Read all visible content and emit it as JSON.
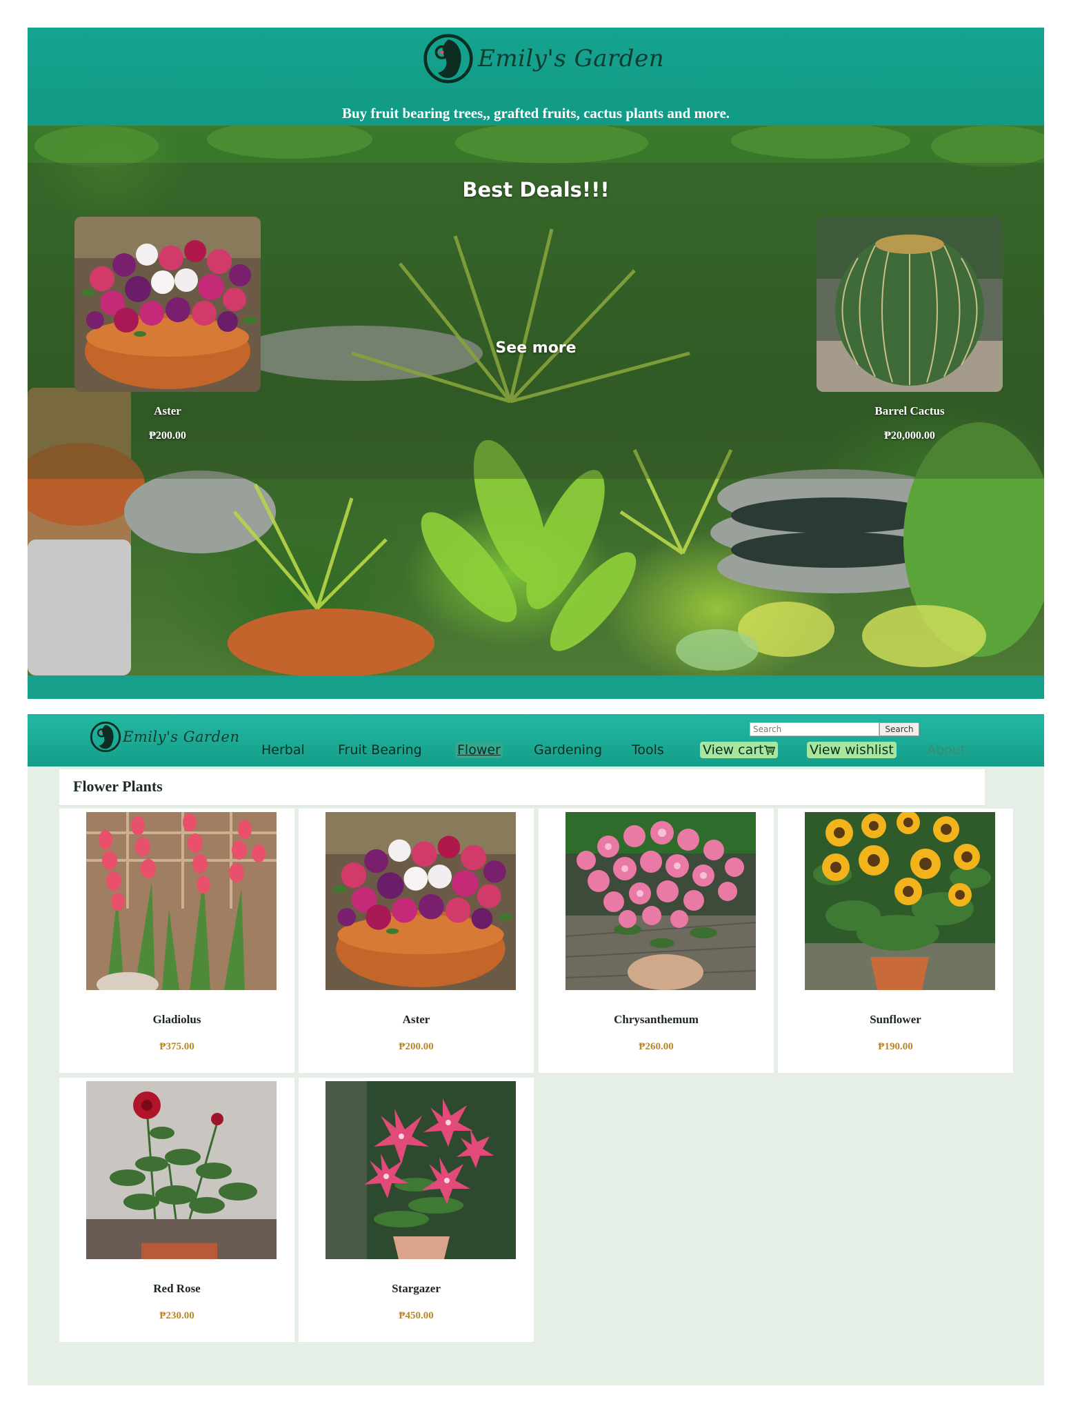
{
  "brand": {
    "name": "Emily's Garden",
    "tagline": "Buy fruit bearing trees,, grafted fruits, cactus plants and more."
  },
  "hero": {
    "deals_title": "Best Deals!!!",
    "see_more": "See more",
    "deals": [
      {
        "name": "Aster",
        "price": "₱200.00",
        "image": "aster-photo"
      },
      {
        "name": "Barrel Cactus",
        "price": "₱20,000.00",
        "image": "barrel-cactus-photo"
      }
    ]
  },
  "nav": {
    "items": [
      {
        "label": "Herbal"
      },
      {
        "label": "Fruit Bearing"
      },
      {
        "label": "Flower",
        "active": true
      },
      {
        "label": "Gardening"
      },
      {
        "label": "Tools"
      },
      {
        "label": "View cart",
        "icon": "cart-icon"
      },
      {
        "label": "View wishlist"
      },
      {
        "label": "About"
      }
    ],
    "search": {
      "placeholder": "Search",
      "button": "Search"
    }
  },
  "section": {
    "title": "Flower Plants",
    "products": [
      {
        "name": "Gladiolus",
        "price": "₱375.00",
        "image": "gladiolus-photo"
      },
      {
        "name": "Aster",
        "price": "₱200.00",
        "image": "aster-photo"
      },
      {
        "name": "Chrysanthemum",
        "price": "₱260.00",
        "image": "chrysanthemum-photo"
      },
      {
        "name": "Sunflower",
        "price": "₱190.00",
        "image": "sunflower-photo"
      },
      {
        "name": "Red Rose",
        "price": "₱230.00",
        "image": "red-rose-photo"
      },
      {
        "name": "Stargazer",
        "price": "₱450.00",
        "image": "stargazer-photo"
      }
    ]
  },
  "colors": {
    "brand_teal": "#16a08c",
    "shop_background": "#e6efe6",
    "price_gold": "#b8862c",
    "pill_green": "#a6e69d"
  }
}
